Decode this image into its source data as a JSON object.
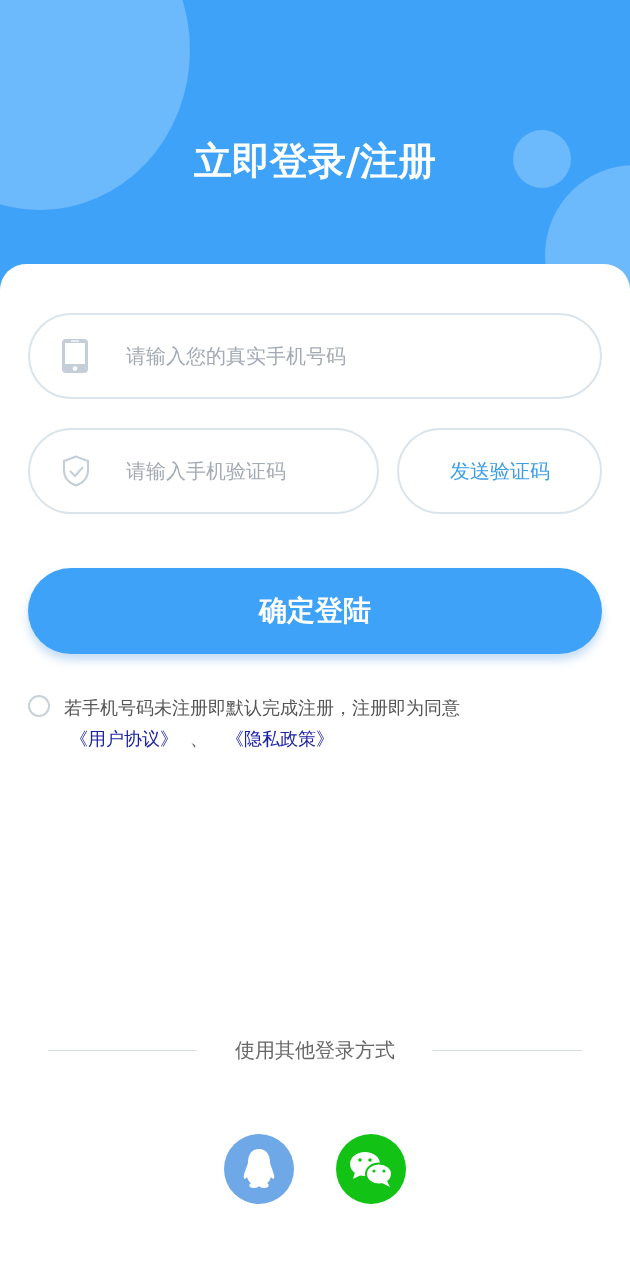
{
  "header": {
    "title": "立即登录/注册"
  },
  "phone_field": {
    "placeholder": "请输入您的真实手机号码"
  },
  "code_field": {
    "placeholder": "请输入手机验证码"
  },
  "send_code_button": {
    "label": "发送验证码"
  },
  "submit_button": {
    "label": "确定登陆"
  },
  "agreement": {
    "checked": false,
    "text": "若手机号码未注册即默认完成注册，注册即为同意",
    "links": [
      "《用户协议》",
      "《隐私政策》"
    ],
    "separator": "、"
  },
  "other_login": {
    "label": "使用其他登录方式",
    "providers": [
      {
        "kind": "qq"
      },
      {
        "kind": "wechat"
      }
    ]
  }
}
